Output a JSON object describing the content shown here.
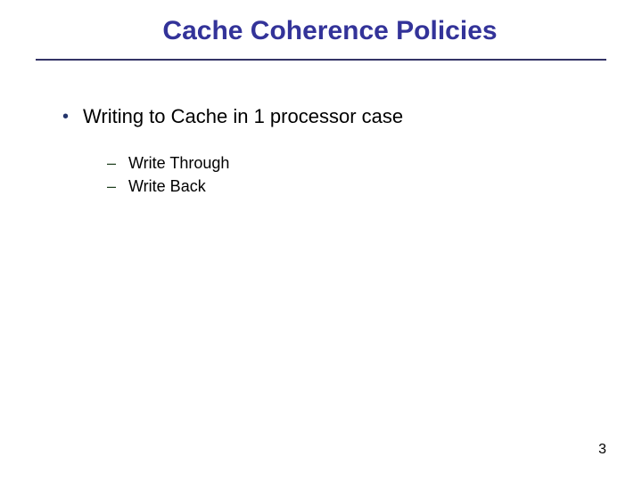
{
  "title": "Cache Coherence Policies",
  "bullets": [
    {
      "text": "Writing to Cache in 1 processor case",
      "subitems": [
        "Write Through",
        "Write Back"
      ]
    }
  ],
  "page_number": "3"
}
